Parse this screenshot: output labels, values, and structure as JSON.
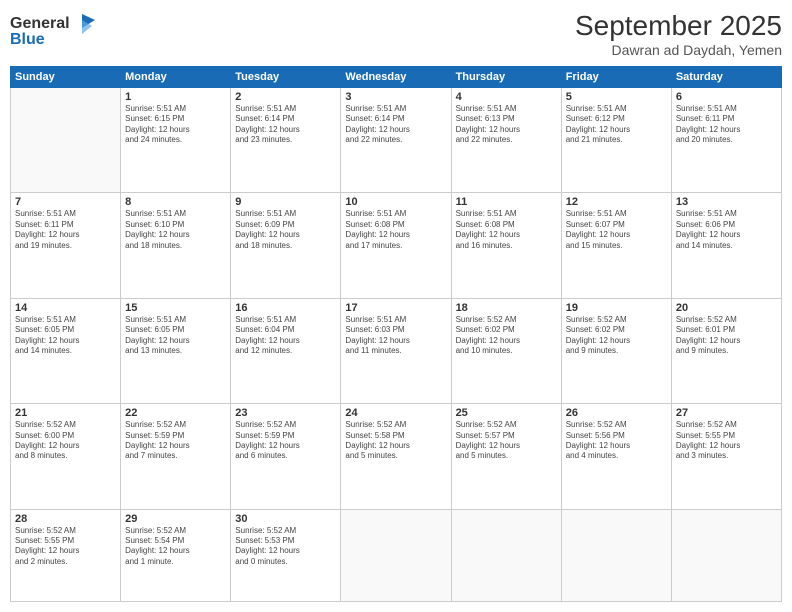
{
  "logo": {
    "line1": "General",
    "line2": "Blue"
  },
  "header": {
    "month": "September 2025",
    "location": "Dawran ad Daydah, Yemen"
  },
  "weekdays": [
    "Sunday",
    "Monday",
    "Tuesday",
    "Wednesday",
    "Thursday",
    "Friday",
    "Saturday"
  ],
  "weeks": [
    [
      {
        "day": "",
        "info": ""
      },
      {
        "day": "1",
        "info": "Sunrise: 5:51 AM\nSunset: 6:15 PM\nDaylight: 12 hours\nand 24 minutes."
      },
      {
        "day": "2",
        "info": "Sunrise: 5:51 AM\nSunset: 6:14 PM\nDaylight: 12 hours\nand 23 minutes."
      },
      {
        "day": "3",
        "info": "Sunrise: 5:51 AM\nSunset: 6:14 PM\nDaylight: 12 hours\nand 22 minutes."
      },
      {
        "day": "4",
        "info": "Sunrise: 5:51 AM\nSunset: 6:13 PM\nDaylight: 12 hours\nand 22 minutes."
      },
      {
        "day": "5",
        "info": "Sunrise: 5:51 AM\nSunset: 6:12 PM\nDaylight: 12 hours\nand 21 minutes."
      },
      {
        "day": "6",
        "info": "Sunrise: 5:51 AM\nSunset: 6:11 PM\nDaylight: 12 hours\nand 20 minutes."
      }
    ],
    [
      {
        "day": "7",
        "info": "Sunrise: 5:51 AM\nSunset: 6:11 PM\nDaylight: 12 hours\nand 19 minutes."
      },
      {
        "day": "8",
        "info": "Sunrise: 5:51 AM\nSunset: 6:10 PM\nDaylight: 12 hours\nand 18 minutes."
      },
      {
        "day": "9",
        "info": "Sunrise: 5:51 AM\nSunset: 6:09 PM\nDaylight: 12 hours\nand 18 minutes."
      },
      {
        "day": "10",
        "info": "Sunrise: 5:51 AM\nSunset: 6:08 PM\nDaylight: 12 hours\nand 17 minutes."
      },
      {
        "day": "11",
        "info": "Sunrise: 5:51 AM\nSunset: 6:08 PM\nDaylight: 12 hours\nand 16 minutes."
      },
      {
        "day": "12",
        "info": "Sunrise: 5:51 AM\nSunset: 6:07 PM\nDaylight: 12 hours\nand 15 minutes."
      },
      {
        "day": "13",
        "info": "Sunrise: 5:51 AM\nSunset: 6:06 PM\nDaylight: 12 hours\nand 14 minutes."
      }
    ],
    [
      {
        "day": "14",
        "info": "Sunrise: 5:51 AM\nSunset: 6:05 PM\nDaylight: 12 hours\nand 14 minutes."
      },
      {
        "day": "15",
        "info": "Sunrise: 5:51 AM\nSunset: 6:05 PM\nDaylight: 12 hours\nand 13 minutes."
      },
      {
        "day": "16",
        "info": "Sunrise: 5:51 AM\nSunset: 6:04 PM\nDaylight: 12 hours\nand 12 minutes."
      },
      {
        "day": "17",
        "info": "Sunrise: 5:51 AM\nSunset: 6:03 PM\nDaylight: 12 hours\nand 11 minutes."
      },
      {
        "day": "18",
        "info": "Sunrise: 5:52 AM\nSunset: 6:02 PM\nDaylight: 12 hours\nand 10 minutes."
      },
      {
        "day": "19",
        "info": "Sunrise: 5:52 AM\nSunset: 6:02 PM\nDaylight: 12 hours\nand 9 minutes."
      },
      {
        "day": "20",
        "info": "Sunrise: 5:52 AM\nSunset: 6:01 PM\nDaylight: 12 hours\nand 9 minutes."
      }
    ],
    [
      {
        "day": "21",
        "info": "Sunrise: 5:52 AM\nSunset: 6:00 PM\nDaylight: 12 hours\nand 8 minutes."
      },
      {
        "day": "22",
        "info": "Sunrise: 5:52 AM\nSunset: 5:59 PM\nDaylight: 12 hours\nand 7 minutes."
      },
      {
        "day": "23",
        "info": "Sunrise: 5:52 AM\nSunset: 5:59 PM\nDaylight: 12 hours\nand 6 minutes."
      },
      {
        "day": "24",
        "info": "Sunrise: 5:52 AM\nSunset: 5:58 PM\nDaylight: 12 hours\nand 5 minutes."
      },
      {
        "day": "25",
        "info": "Sunrise: 5:52 AM\nSunset: 5:57 PM\nDaylight: 12 hours\nand 5 minutes."
      },
      {
        "day": "26",
        "info": "Sunrise: 5:52 AM\nSunset: 5:56 PM\nDaylight: 12 hours\nand 4 minutes."
      },
      {
        "day": "27",
        "info": "Sunrise: 5:52 AM\nSunset: 5:55 PM\nDaylight: 12 hours\nand 3 minutes."
      }
    ],
    [
      {
        "day": "28",
        "info": "Sunrise: 5:52 AM\nSunset: 5:55 PM\nDaylight: 12 hours\nand 2 minutes."
      },
      {
        "day": "29",
        "info": "Sunrise: 5:52 AM\nSunset: 5:54 PM\nDaylight: 12 hours\nand 1 minute."
      },
      {
        "day": "30",
        "info": "Sunrise: 5:52 AM\nSunset: 5:53 PM\nDaylight: 12 hours\nand 0 minutes."
      },
      {
        "day": "",
        "info": ""
      },
      {
        "day": "",
        "info": ""
      },
      {
        "day": "",
        "info": ""
      },
      {
        "day": "",
        "info": ""
      }
    ]
  ]
}
